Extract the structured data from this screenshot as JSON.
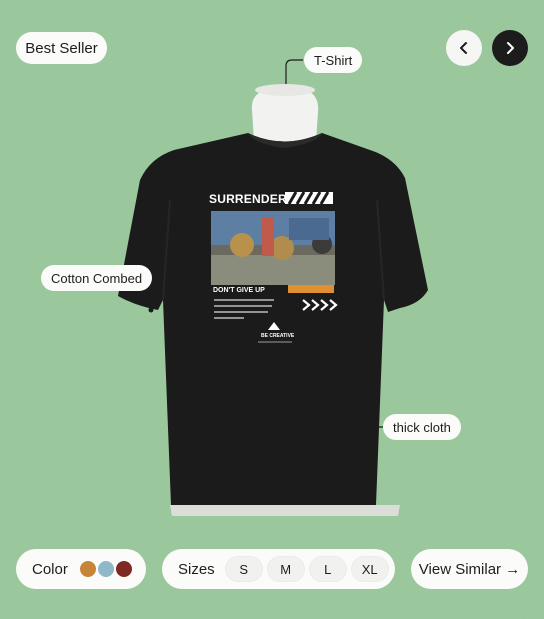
{
  "badge": {
    "label": "Best Seller"
  },
  "nav": {
    "prev_icon": "chevron-left-icon",
    "next_icon": "chevron-right-icon"
  },
  "annotations": {
    "tshirt": "T-Shirt",
    "cotton": "Cotton Combed",
    "thick": "thick cloth"
  },
  "print": {
    "headline": "SURRENDER",
    "slogan": "DON'T GIVE UP",
    "brand": "BE CREATIVE"
  },
  "color": {
    "label": "Color",
    "swatches": [
      "#c88537",
      "#8fb8c9",
      "#7d2a24"
    ]
  },
  "sizes": {
    "label": "Sizes",
    "options": [
      "S",
      "M",
      "L",
      "XL"
    ]
  },
  "view_similar": {
    "label": "View Similar →"
  },
  "colors": {
    "background": "#9bc79d",
    "shirt": "#1b1b1b",
    "pill": "#fbfcfa"
  }
}
